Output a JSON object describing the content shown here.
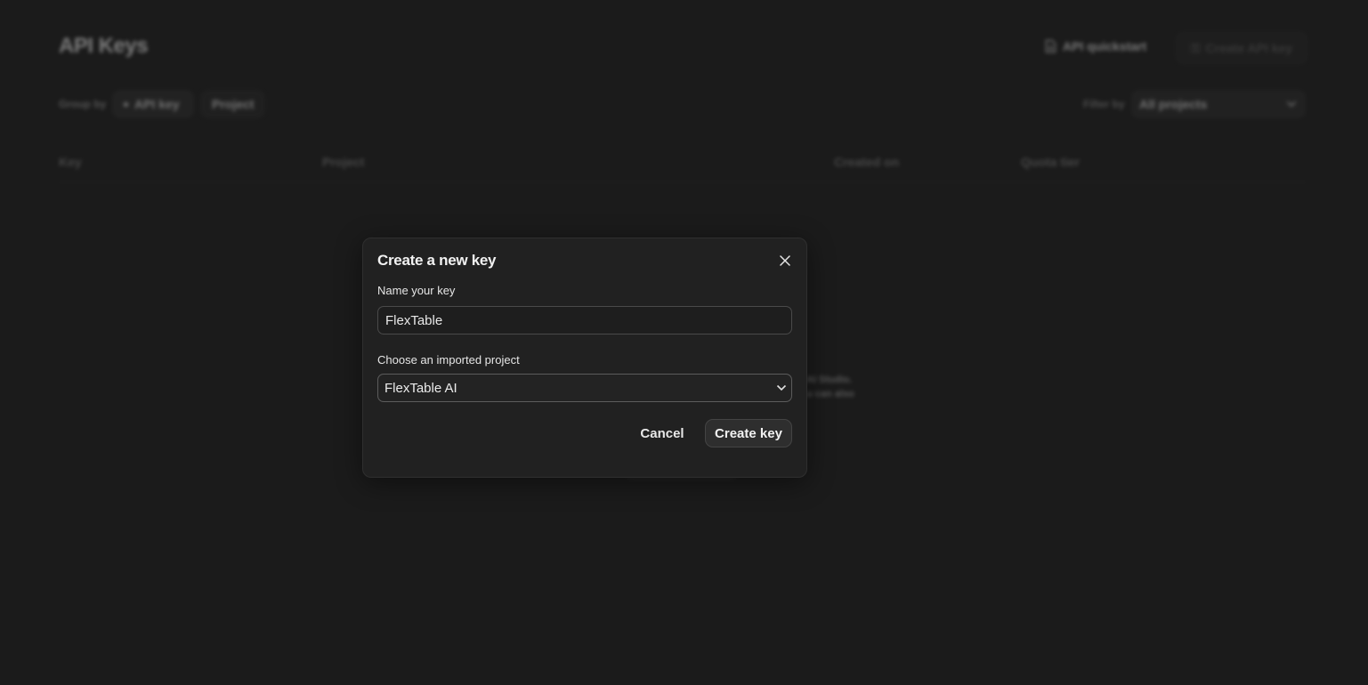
{
  "background": {
    "page_title": "API Keys",
    "quickstart_label": "API quickstart",
    "create_api_key_label": "Create API key",
    "group_by_label": "Group by",
    "group_chips": [
      "API key",
      "Project"
    ],
    "filter_label": "Filter by",
    "filter_value": "All projects",
    "table_headers": [
      "Key",
      "Project",
      "Created on",
      "Quota tier"
    ],
    "empty_state_fragments": [
      "AI Studio.",
      "u can also"
    ]
  },
  "dialog": {
    "title": "Create a new key",
    "name_label": "Name your key",
    "name_value": "FlexTable",
    "project_label": "Choose an imported project",
    "project_value": "FlexTable AI",
    "cancel_label": "Cancel",
    "create_label": "Create key"
  },
  "icons": {
    "close": "close-icon",
    "chevron": "chevron-down-icon",
    "doc": "doc-icon",
    "key": "key-icon"
  }
}
